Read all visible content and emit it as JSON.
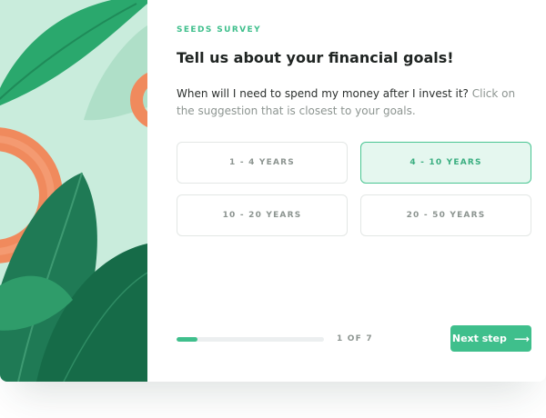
{
  "survey": {
    "eyebrow": "SEEDS SURVEY",
    "title": "Tell us about your financial goals!",
    "question": "When will I need to spend my money after I invest it?",
    "hint": "Click on the suggestion that is closest to your goals."
  },
  "options": [
    {
      "label": "1 - 4 YEARS",
      "selected": false
    },
    {
      "label": "4 - 10 YEARS",
      "selected": true
    },
    {
      "label": "10 - 20 YEARS",
      "selected": false
    },
    {
      "label": "20 - 50 YEARS",
      "selected": false
    }
  ],
  "progress": {
    "fraction": 0.14,
    "label": "1 OF 7"
  },
  "next": {
    "label": "Next step",
    "icon": "arrow-right-icon"
  },
  "colors": {
    "accent": "#3fbf8c",
    "selected_bg": "#e5f7ef",
    "leaf_dark": "#1f7a55",
    "leaf_mid": "#2aa86d",
    "ring": "#f08a5d",
    "art_bg": "#c9ecdc"
  }
}
